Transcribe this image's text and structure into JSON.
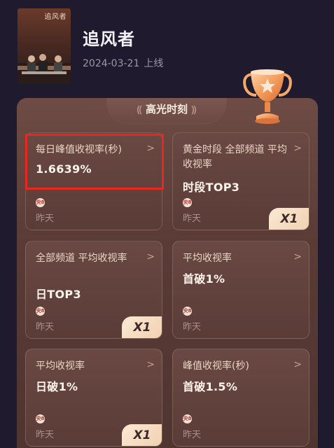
{
  "show": {
    "poster_text": "追风者",
    "title": "追风者",
    "release_date": "2024-03-21",
    "release_label": "上线"
  },
  "panel": {
    "title": "高光时刻"
  },
  "cards": [
    {
      "label": "每日峰值收视率(秒)",
      "value": "1.6639%",
      "logo": "央8",
      "time": "昨天",
      "badge": ""
    },
    {
      "label": "黄金时段 全部频道 平均收视率",
      "value": "时段TOP3",
      "logo": "央8",
      "time": "昨天",
      "badge": "X1"
    },
    {
      "label": "全部频道 平均收视率",
      "value": "日TOP3",
      "logo": "央8",
      "time": "昨天",
      "badge": "X1"
    },
    {
      "label": "平均收视率",
      "value": "首破1%",
      "logo": "央8",
      "time": "昨天",
      "badge": ""
    },
    {
      "label": "平均收视率",
      "value": "日破1%",
      "logo": "央8",
      "time": "昨天",
      "badge": "X1"
    },
    {
      "label": "峰值收视率(秒)",
      "value": "首破1.5%",
      "logo": "央8",
      "time": "昨天",
      "badge": ""
    }
  ],
  "icons": {
    "chevron": "chevron-right-icon",
    "trophy": "trophy-icon",
    "laurel": "laurel-icon",
    "channel_logo": "cctv8-logo-icon"
  },
  "colors": {
    "background": "#1f1a2e",
    "panel": "#5a3b36",
    "highlight": "#e8281e",
    "badge": "#f6dcc2"
  }
}
